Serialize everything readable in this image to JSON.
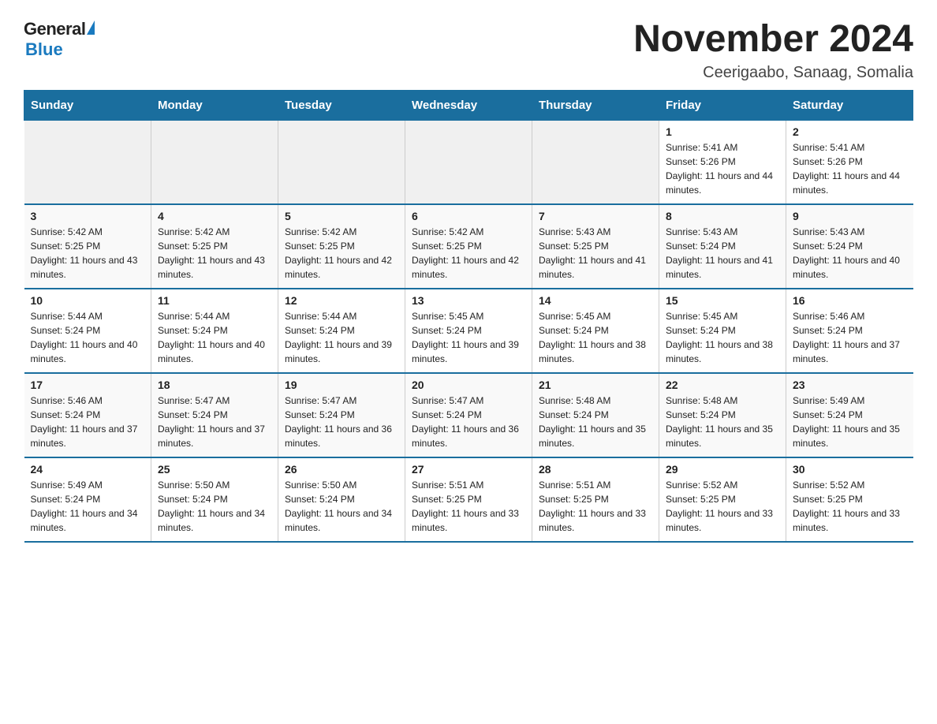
{
  "logo": {
    "general": "General",
    "blue": "Blue"
  },
  "title": "November 2024",
  "location": "Ceerigaabo, Sanaag, Somalia",
  "days_of_week": [
    "Sunday",
    "Monday",
    "Tuesday",
    "Wednesday",
    "Thursday",
    "Friday",
    "Saturday"
  ],
  "weeks": [
    [
      {
        "day": "",
        "sunrise": "",
        "sunset": "",
        "daylight": ""
      },
      {
        "day": "",
        "sunrise": "",
        "sunset": "",
        "daylight": ""
      },
      {
        "day": "",
        "sunrise": "",
        "sunset": "",
        "daylight": ""
      },
      {
        "day": "",
        "sunrise": "",
        "sunset": "",
        "daylight": ""
      },
      {
        "day": "",
        "sunrise": "",
        "sunset": "",
        "daylight": ""
      },
      {
        "day": "1",
        "sunrise": "Sunrise: 5:41 AM",
        "sunset": "Sunset: 5:26 PM",
        "daylight": "Daylight: 11 hours and 44 minutes."
      },
      {
        "day": "2",
        "sunrise": "Sunrise: 5:41 AM",
        "sunset": "Sunset: 5:26 PM",
        "daylight": "Daylight: 11 hours and 44 minutes."
      }
    ],
    [
      {
        "day": "3",
        "sunrise": "Sunrise: 5:42 AM",
        "sunset": "Sunset: 5:25 PM",
        "daylight": "Daylight: 11 hours and 43 minutes."
      },
      {
        "day": "4",
        "sunrise": "Sunrise: 5:42 AM",
        "sunset": "Sunset: 5:25 PM",
        "daylight": "Daylight: 11 hours and 43 minutes."
      },
      {
        "day": "5",
        "sunrise": "Sunrise: 5:42 AM",
        "sunset": "Sunset: 5:25 PM",
        "daylight": "Daylight: 11 hours and 42 minutes."
      },
      {
        "day": "6",
        "sunrise": "Sunrise: 5:42 AM",
        "sunset": "Sunset: 5:25 PM",
        "daylight": "Daylight: 11 hours and 42 minutes."
      },
      {
        "day": "7",
        "sunrise": "Sunrise: 5:43 AM",
        "sunset": "Sunset: 5:25 PM",
        "daylight": "Daylight: 11 hours and 41 minutes."
      },
      {
        "day": "8",
        "sunrise": "Sunrise: 5:43 AM",
        "sunset": "Sunset: 5:24 PM",
        "daylight": "Daylight: 11 hours and 41 minutes."
      },
      {
        "day": "9",
        "sunrise": "Sunrise: 5:43 AM",
        "sunset": "Sunset: 5:24 PM",
        "daylight": "Daylight: 11 hours and 40 minutes."
      }
    ],
    [
      {
        "day": "10",
        "sunrise": "Sunrise: 5:44 AM",
        "sunset": "Sunset: 5:24 PM",
        "daylight": "Daylight: 11 hours and 40 minutes."
      },
      {
        "day": "11",
        "sunrise": "Sunrise: 5:44 AM",
        "sunset": "Sunset: 5:24 PM",
        "daylight": "Daylight: 11 hours and 40 minutes."
      },
      {
        "day": "12",
        "sunrise": "Sunrise: 5:44 AM",
        "sunset": "Sunset: 5:24 PM",
        "daylight": "Daylight: 11 hours and 39 minutes."
      },
      {
        "day": "13",
        "sunrise": "Sunrise: 5:45 AM",
        "sunset": "Sunset: 5:24 PM",
        "daylight": "Daylight: 11 hours and 39 minutes."
      },
      {
        "day": "14",
        "sunrise": "Sunrise: 5:45 AM",
        "sunset": "Sunset: 5:24 PM",
        "daylight": "Daylight: 11 hours and 38 minutes."
      },
      {
        "day": "15",
        "sunrise": "Sunrise: 5:45 AM",
        "sunset": "Sunset: 5:24 PM",
        "daylight": "Daylight: 11 hours and 38 minutes."
      },
      {
        "day": "16",
        "sunrise": "Sunrise: 5:46 AM",
        "sunset": "Sunset: 5:24 PM",
        "daylight": "Daylight: 11 hours and 37 minutes."
      }
    ],
    [
      {
        "day": "17",
        "sunrise": "Sunrise: 5:46 AM",
        "sunset": "Sunset: 5:24 PM",
        "daylight": "Daylight: 11 hours and 37 minutes."
      },
      {
        "day": "18",
        "sunrise": "Sunrise: 5:47 AM",
        "sunset": "Sunset: 5:24 PM",
        "daylight": "Daylight: 11 hours and 37 minutes."
      },
      {
        "day": "19",
        "sunrise": "Sunrise: 5:47 AM",
        "sunset": "Sunset: 5:24 PM",
        "daylight": "Daylight: 11 hours and 36 minutes."
      },
      {
        "day": "20",
        "sunrise": "Sunrise: 5:47 AM",
        "sunset": "Sunset: 5:24 PM",
        "daylight": "Daylight: 11 hours and 36 minutes."
      },
      {
        "day": "21",
        "sunrise": "Sunrise: 5:48 AM",
        "sunset": "Sunset: 5:24 PM",
        "daylight": "Daylight: 11 hours and 35 minutes."
      },
      {
        "day": "22",
        "sunrise": "Sunrise: 5:48 AM",
        "sunset": "Sunset: 5:24 PM",
        "daylight": "Daylight: 11 hours and 35 minutes."
      },
      {
        "day": "23",
        "sunrise": "Sunrise: 5:49 AM",
        "sunset": "Sunset: 5:24 PM",
        "daylight": "Daylight: 11 hours and 35 minutes."
      }
    ],
    [
      {
        "day": "24",
        "sunrise": "Sunrise: 5:49 AM",
        "sunset": "Sunset: 5:24 PM",
        "daylight": "Daylight: 11 hours and 34 minutes."
      },
      {
        "day": "25",
        "sunrise": "Sunrise: 5:50 AM",
        "sunset": "Sunset: 5:24 PM",
        "daylight": "Daylight: 11 hours and 34 minutes."
      },
      {
        "day": "26",
        "sunrise": "Sunrise: 5:50 AM",
        "sunset": "Sunset: 5:24 PM",
        "daylight": "Daylight: 11 hours and 34 minutes."
      },
      {
        "day": "27",
        "sunrise": "Sunrise: 5:51 AM",
        "sunset": "Sunset: 5:25 PM",
        "daylight": "Daylight: 11 hours and 33 minutes."
      },
      {
        "day": "28",
        "sunrise": "Sunrise: 5:51 AM",
        "sunset": "Sunset: 5:25 PM",
        "daylight": "Daylight: 11 hours and 33 minutes."
      },
      {
        "day": "29",
        "sunrise": "Sunrise: 5:52 AM",
        "sunset": "Sunset: 5:25 PM",
        "daylight": "Daylight: 11 hours and 33 minutes."
      },
      {
        "day": "30",
        "sunrise": "Sunrise: 5:52 AM",
        "sunset": "Sunset: 5:25 PM",
        "daylight": "Daylight: 11 hours and 33 minutes."
      }
    ]
  ]
}
